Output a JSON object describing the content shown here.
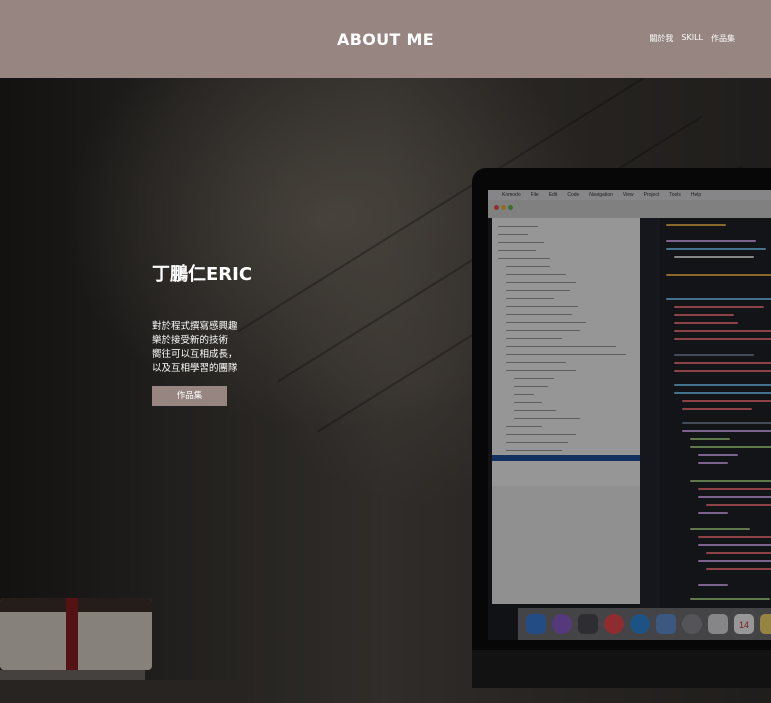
{
  "header": {
    "title": "ABOUT ME",
    "nav": [
      "關於我",
      "SKILL",
      "作品集"
    ]
  },
  "hero": {
    "name": "丁鵬仁ERIC",
    "description_lines": [
      "對於程式撰寫感興趣",
      "樂於接受新的技術",
      "嚮往可以互相成長，",
      "以及互相學習的團隊"
    ],
    "cta_label": "作品集"
  },
  "background": {
    "laptop_menu": [
      "Komodo",
      "File",
      "Edit",
      "Code",
      "Navigation",
      "View",
      "Project",
      "Tools",
      "Help"
    ],
    "dock_date": "14"
  },
  "colors": {
    "header_bg": "#968580",
    "accent": "#968580",
    "text": "#ffffff"
  }
}
